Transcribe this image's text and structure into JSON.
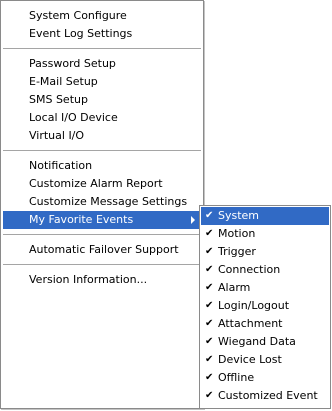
{
  "main_menu": {
    "groups": [
      [
        "System Configure",
        "Event Log Settings"
      ],
      [
        "Password Setup",
        "E-Mail Setup",
        "SMS Setup",
        "Local I/O Device",
        "Virtual I/O"
      ],
      [
        "Notification",
        "Customize Alarm Report",
        "Customize Message Settings",
        "My Favorite Events"
      ],
      [
        "Automatic Failover Support"
      ],
      [
        "Version Information..."
      ]
    ],
    "active_item": "My Favorite Events"
  },
  "submenu": {
    "check_glyph": "✔",
    "items": [
      {
        "label": "System",
        "checked": true,
        "active": true
      },
      {
        "label": "Motion",
        "checked": true,
        "active": false
      },
      {
        "label": "Trigger",
        "checked": true,
        "active": false
      },
      {
        "label": "Connection",
        "checked": true,
        "active": false
      },
      {
        "label": "Alarm",
        "checked": true,
        "active": false
      },
      {
        "label": "Login/Logout",
        "checked": true,
        "active": false
      },
      {
        "label": "Attachment",
        "checked": true,
        "active": false
      },
      {
        "label": "Wiegand Data",
        "checked": true,
        "active": false
      },
      {
        "label": "Device Lost",
        "checked": true,
        "active": false
      },
      {
        "label": "Offline",
        "checked": true,
        "active": false
      },
      {
        "label": "Customized Event",
        "checked": true,
        "active": false
      }
    ]
  },
  "colors": {
    "highlight": "#316ac5",
    "highlight_text": "#ffffff",
    "border": "#8a8a8a"
  }
}
